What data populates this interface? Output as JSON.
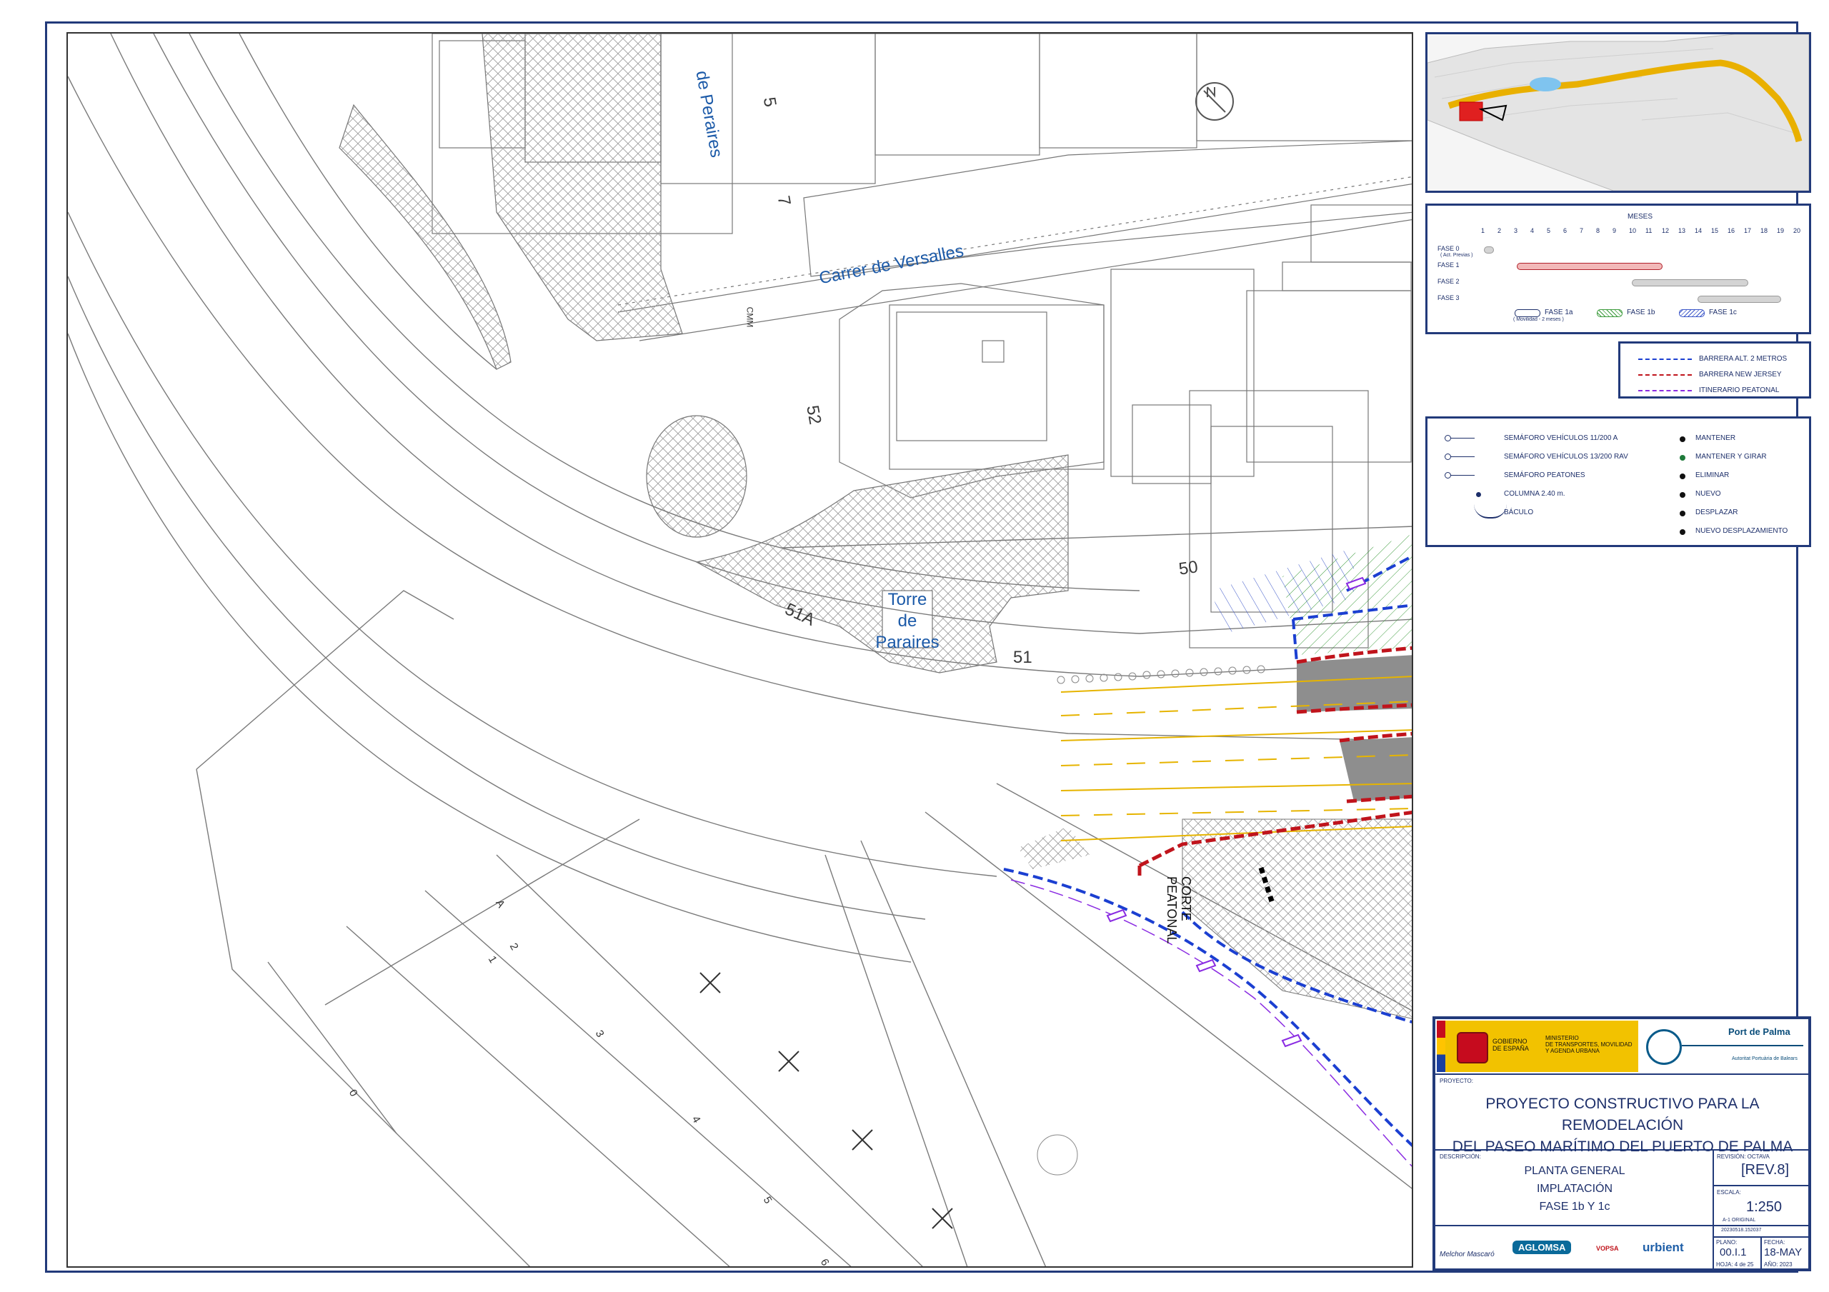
{
  "map": {
    "street_names": {
      "versalles": "Carrer de Versalles",
      "peraires": "de Peraires",
      "torre": "Torre\nde\nParaires"
    },
    "numbers": {
      "n5": "5",
      "n7": "7",
      "n52": "52",
      "n50": "50",
      "n51": "51",
      "n51a": "51A",
      "cmm": "CMM",
      "corte": "CORTE\nPEATONAL"
    },
    "row_numbers": [
      "0",
      "1",
      "2",
      "3",
      "4",
      "5",
      "6",
      "A"
    ],
    "colors": {
      "blue_barrier": "#1b3fd1",
      "red_barrier": "#c0141c",
      "yellow_lane": "#e6b400",
      "pedestrian": "#8a2be2",
      "asphalt": "#8e8e8e",
      "hatch_green": "#3a9a3a"
    }
  },
  "keyplan": {
    "route_color": "#e9b000",
    "site_color": "#e02020"
  },
  "schedule": {
    "title": "MESES",
    "months": [
      "1",
      "2",
      "3",
      "4",
      "5",
      "6",
      "7",
      "8",
      "9",
      "10",
      "11",
      "12",
      "13",
      "14",
      "15",
      "16",
      "17",
      "18",
      "19",
      "20"
    ],
    "phases": [
      {
        "label": "FASE 0",
        "sublabel": "( Act. Previas )",
        "start": 1,
        "end": 1.5,
        "style": "fase1a"
      },
      {
        "label": "FASE 1",
        "sublabel": "",
        "start": 3,
        "end": 11.8,
        "style": "fase1"
      },
      {
        "label": "FASE 2",
        "sublabel": "",
        "start": 10,
        "end": 17,
        "style": "gray"
      },
      {
        "label": "FASE 3",
        "sublabel": "",
        "start": 14,
        "end": 19,
        "style": "gray"
      }
    ],
    "legend": [
      {
        "label": "FASE 1a",
        "sublabel": "( Movilidad - 2 meses )"
      },
      {
        "label": "FASE 1b",
        "sublabel": ""
      },
      {
        "label": "FASE 1c",
        "sublabel": ""
      }
    ]
  },
  "barrier_legend": [
    {
      "label": "BARRERA ALT. 2 METROS",
      "color": "#1b3fd1"
    },
    {
      "label": "BARRERA NEW JERSEY",
      "color": "#c0141c"
    },
    {
      "label": "ITINERARIO  PEATONAL",
      "color": "#8a2be2"
    }
  ],
  "symbols_legend": {
    "left": [
      {
        "label": "SEMÁFORO VEHÍCULOS 11/200 A",
        "icon": "signal-open-icon"
      },
      {
        "label": "SEMÁFORO VEHÍCULOS 13/200 RAV",
        "icon": "signal-filled-icon"
      },
      {
        "label": "SEMÁFORO PEATONES",
        "icon": "signal-pedestrian-icon"
      },
      {
        "label": "COLUMNA 2.40 m.",
        "icon": "column-dot-icon"
      },
      {
        "label": "BÁCULO",
        "icon": "baculo-icon"
      }
    ],
    "right": [
      {
        "label": "MANTENER",
        "color": "#111111"
      },
      {
        "label": "MANTENER Y GIRAR",
        "color": "#1f7a3a"
      },
      {
        "label": "ELIMINAR",
        "color": "#111111"
      },
      {
        "label": "NUEVO",
        "color": "#111111"
      },
      {
        "label": "DESPLAZAR",
        "color": "#111111"
      },
      {
        "label": "NUEVO DESPLAZAMIENTO",
        "color": "#111111"
      }
    ]
  },
  "title_block": {
    "gob_text": "GOBIERNO\nDE ESPAÑA",
    "ministerio": "MINISTERIO\nDE TRANSPORTES, MOVILIDAD\nY AGENDA URBANA",
    "port_name": "Port de Palma",
    "port_sub": "Autoritat Portuària de Balears",
    "proyecto_label": "PROYECTO:",
    "proyecto": "PROYECTO CONSTRUCTIVO PARA LA REMODELACIÓN\nDEL PASEO MARÍTIMO DEL PUERTO DE PALMA",
    "descripcion_label": "DESCRIPCIÓN:",
    "descripcion": "PLANTA GENERAL\nIMPLATACIÓN\nFASE 1b Y 1c",
    "revision_label": "REVISIÓN: OCTAVA",
    "revision": "[REV.8]",
    "escala_label": "ESCALA:",
    "escala": "1:250",
    "escala_note": "A-1 ORIGINAL",
    "file_code": "20230518.152037",
    "plano_label": "PLANO:",
    "plano": "00.I.1",
    "hoja": "HOJA: 4 de 25",
    "fecha_label": "FECHA:",
    "fecha": "18-MAY",
    "anio": "AÑO: 2023",
    "firms": [
      "Melchor Mascaró",
      "AGLOMSA",
      "VOPSA",
      "urbient"
    ]
  }
}
